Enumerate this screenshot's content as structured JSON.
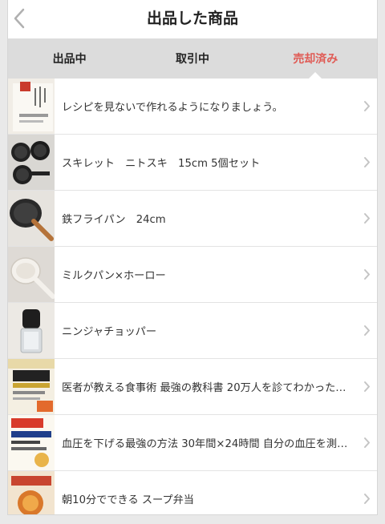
{
  "header": {
    "title": "出品した商品"
  },
  "tabs": [
    {
      "label": "出品中",
      "active": false
    },
    {
      "label": "取引中",
      "active": false
    },
    {
      "label": "売却済み",
      "active": true
    }
  ],
  "colors": {
    "accent": "#e05b55",
    "tab_bar": "#dcdcdc"
  },
  "items": [
    {
      "title": "レシピを見ないで作れるようになりましょう。",
      "thumb": "book-cover-recipe"
    },
    {
      "title": "スキレット　ニトスキ　15cm 5個セット",
      "thumb": "skillet-set"
    },
    {
      "title": "鉄フライパン　24cm",
      "thumb": "iron-frying-pan"
    },
    {
      "title": "ミルクパン×ホーロー",
      "thumb": "enamel-milk-pan"
    },
    {
      "title": "ニンジャチョッパー",
      "thumb": "food-chopper"
    },
    {
      "title": "医者が教える食事術 最強の教科書 20万人を診てわかった医…",
      "thumb": "book-cover-diet"
    },
    {
      "title": "血圧を下げる最強の方法 30年間×24時間 自分の血圧を測り…",
      "thumb": "book-cover-blood-pressure"
    },
    {
      "title": "朝10分でできる スープ弁当",
      "thumb": "book-cover-soup"
    }
  ]
}
